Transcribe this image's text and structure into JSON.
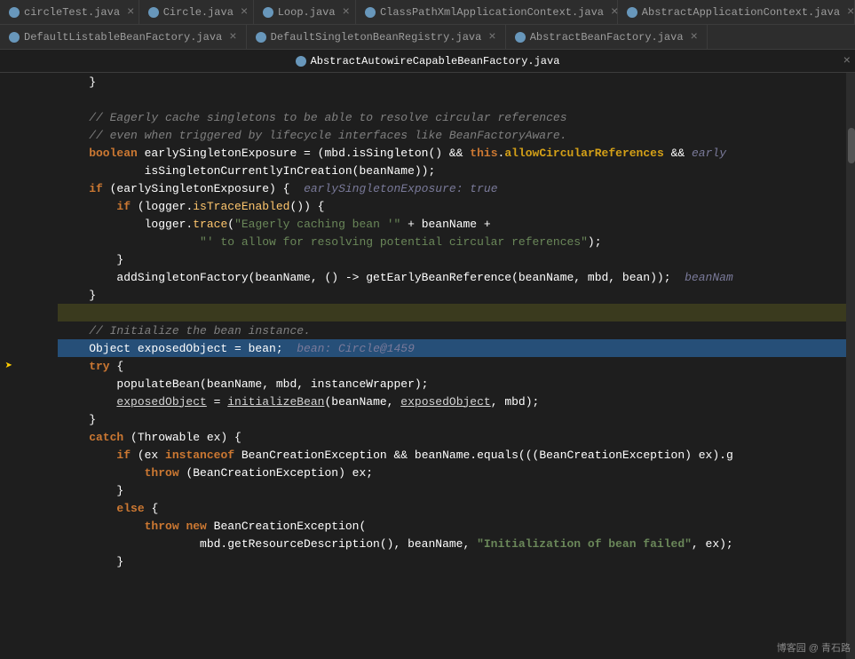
{
  "tabs_row1": [
    {
      "label": "circleTest.java",
      "active": false,
      "color": "#6897bb"
    },
    {
      "label": "Circle.java",
      "active": false,
      "color": "#6897bb"
    },
    {
      "label": "Loop.java",
      "active": false,
      "color": "#6897bb"
    },
    {
      "label": "ClassPathXmlApplicationContext.java",
      "active": false,
      "color": "#6897bb"
    },
    {
      "label": "AbstractApplicationContext.java",
      "active": false,
      "color": "#6897bb"
    }
  ],
  "tabs_row2": [
    {
      "label": "DefaultListableBeanFactory.java",
      "active": false,
      "color": "#6897bb"
    },
    {
      "label": "DefaultSingletonBeanRegistry.java",
      "active": false,
      "color": "#6897bb"
    },
    {
      "label": "AbstractBeanFactory.java",
      "active": false,
      "color": "#6897bb"
    }
  ],
  "active_file": "AbstractAutowireCapableBeanFactory.java",
  "watermark": "博客园 @ 青石路"
}
